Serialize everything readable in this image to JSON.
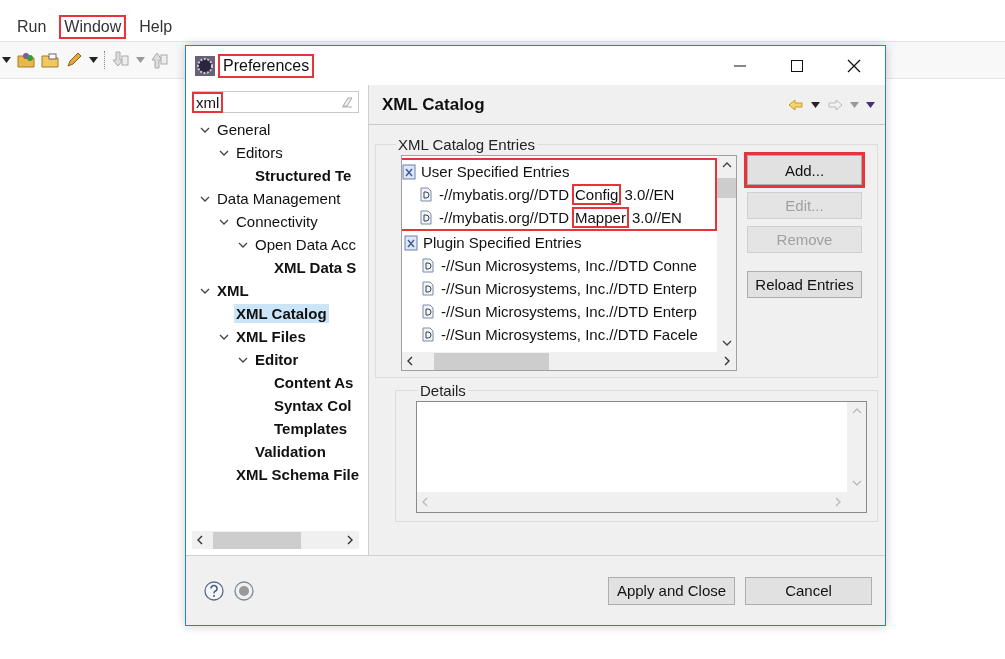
{
  "menu_bar": [
    {
      "label": "Run",
      "annotated": false
    },
    {
      "label": "Window",
      "annotated": true
    },
    {
      "label": "Help",
      "annotated": false
    }
  ],
  "dialog": {
    "title": "Preferences",
    "title_annotated": true,
    "filter": {
      "value": "xml",
      "annotated": true
    },
    "tree": [
      {
        "label": "General",
        "bold": false,
        "selected": false,
        "expanded": true,
        "children": [
          {
            "label": "Editors",
            "bold": false,
            "selected": false,
            "expanded": true,
            "children": [
              {
                "label": "Structured Te",
                "bold": true,
                "selected": false
              }
            ]
          }
        ]
      },
      {
        "label": "Data Management",
        "bold": false,
        "selected": false,
        "expanded": true,
        "children": [
          {
            "label": "Connectivity",
            "bold": false,
            "selected": false,
            "expanded": true,
            "children": [
              {
                "label": "Open Data Acc",
                "bold": false,
                "selected": false,
                "expanded": true,
                "children": [
                  {
                    "label": "XML Data S",
                    "bold": true,
                    "selected": false
                  }
                ]
              }
            ]
          }
        ]
      },
      {
        "label": "XML",
        "bold": true,
        "selected": false,
        "expanded": true,
        "children": [
          {
            "label": "XML Catalog",
            "bold": true,
            "selected": true
          },
          {
            "label": "XML Files",
            "bold": true,
            "selected": false,
            "expanded": true,
            "children": [
              {
                "label": "Editor",
                "bold": true,
                "selected": false,
                "expanded": true,
                "children": [
                  {
                    "label": "Content As",
                    "bold": true,
                    "selected": false
                  },
                  {
                    "label": "Syntax Col",
                    "bold": true,
                    "selected": false
                  },
                  {
                    "label": "Templates",
                    "bold": true,
                    "selected": false
                  }
                ]
              },
              {
                "label": "Validation",
                "bold": true,
                "selected": false
              }
            ]
          },
          {
            "label": "XML Schema File",
            "bold": true,
            "selected": false
          }
        ]
      }
    ],
    "page": {
      "title": "XML Catalog",
      "entries_label": "XML Catalog Entries",
      "entry_groups": [
        {
          "label": "User Specified Entries",
          "annotated": true,
          "entries": [
            {
              "parts": [
                {
                  "text": "-//mybatis.org//DTD ",
                  "annotated": false
                },
                {
                  "text": "Config",
                  "annotated": true
                },
                {
                  "text": " 3.0//EN",
                  "annotated": false
                }
              ]
            },
            {
              "parts": [
                {
                  "text": "-//mybatis.org//DTD ",
                  "annotated": false
                },
                {
                  "text": "Mapper",
                  "annotated": true
                },
                {
                  "text": " 3.0//EN",
                  "annotated": false
                }
              ]
            }
          ]
        },
        {
          "label": "Plugin Specified Entries",
          "annotated": false,
          "entries": [
            {
              "parts": [
                {
                  "text": "-//Sun Microsystems, Inc.//DTD Conne",
                  "annotated": false
                }
              ]
            },
            {
              "parts": [
                {
                  "text": "-//Sun Microsystems, Inc.//DTD Enterp",
                  "annotated": false
                }
              ]
            },
            {
              "parts": [
                {
                  "text": "-//Sun Microsystems, Inc.//DTD Enterp",
                  "annotated": false
                }
              ]
            },
            {
              "parts": [
                {
                  "text": "-//Sun Microsystems, Inc.//DTD Facele",
                  "annotated": false
                }
              ]
            }
          ]
        }
      ],
      "buttons": [
        {
          "label": "Add...",
          "disabled": false,
          "annotated": true
        },
        {
          "label": "Edit...",
          "disabled": true,
          "annotated": false
        },
        {
          "label": "Remove",
          "disabled": true,
          "annotated": false
        },
        {
          "label": "Reload Entries",
          "disabled": false,
          "annotated": false
        }
      ],
      "details_label": "Details"
    },
    "footer_buttons": [
      {
        "label": "Apply and Close"
      },
      {
        "label": "Cancel"
      }
    ]
  }
}
